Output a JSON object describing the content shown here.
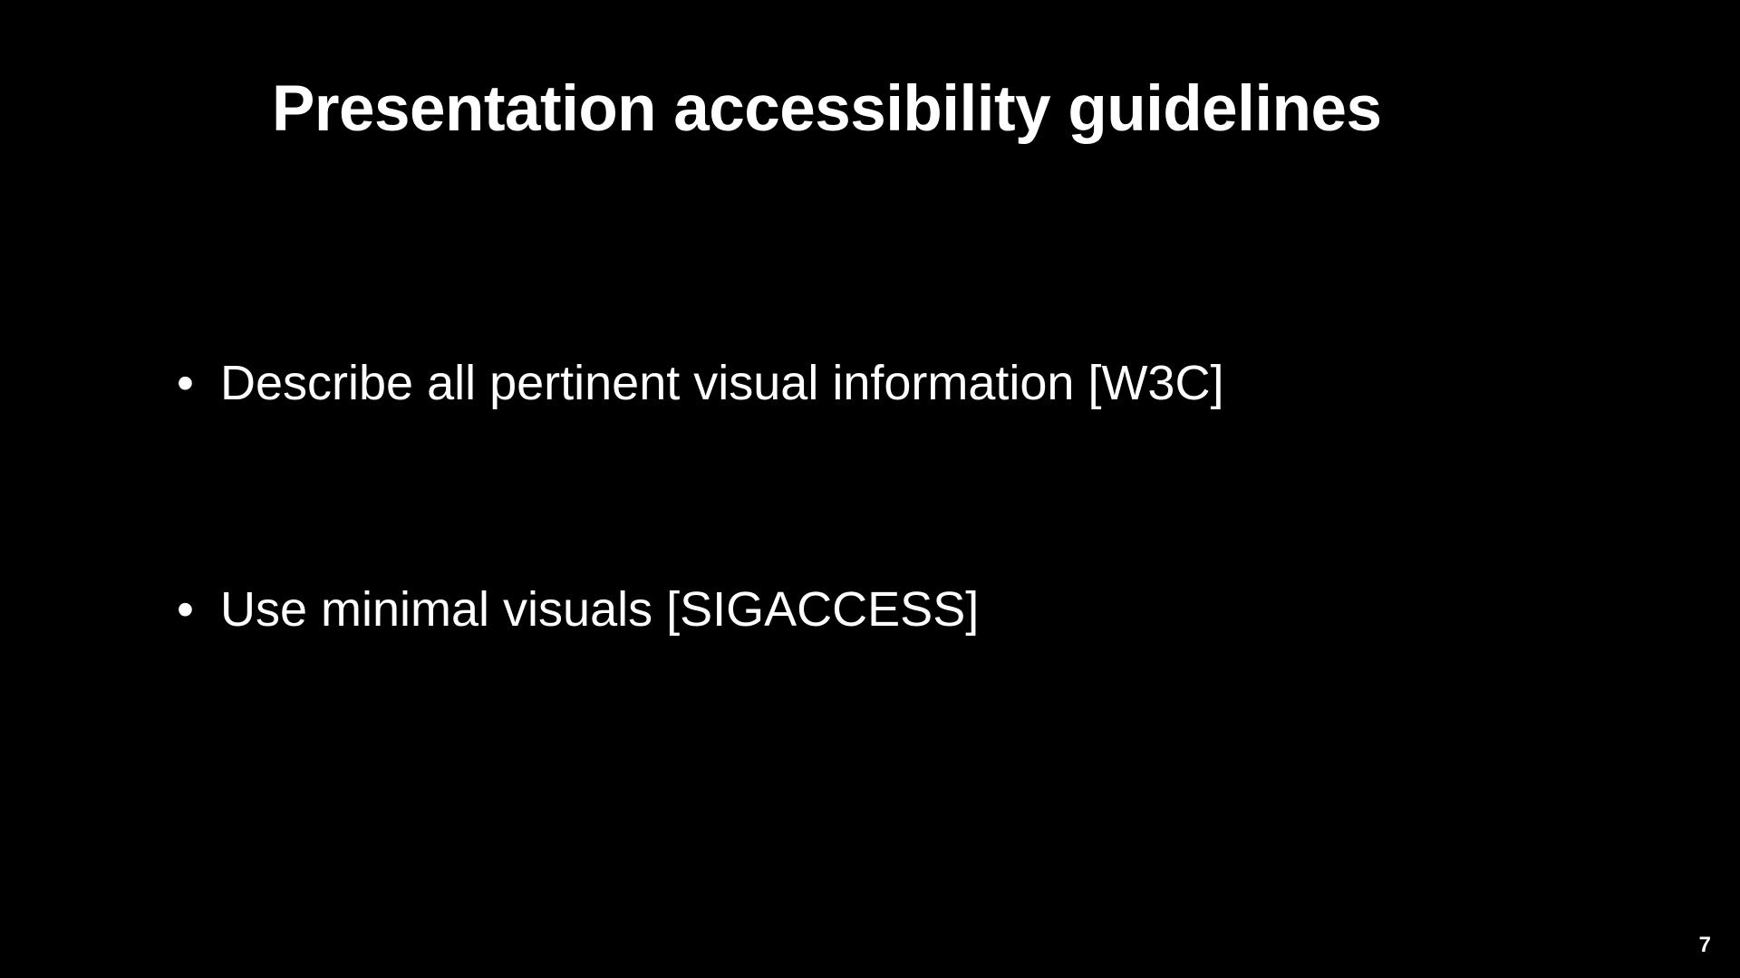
{
  "slide": {
    "title": "Presentation accessibility guidelines",
    "bullets": [
      "Describe all pertinent visual information [W3C]",
      "Use minimal visuals [SIGACCESS]"
    ],
    "pageNumber": "7"
  }
}
